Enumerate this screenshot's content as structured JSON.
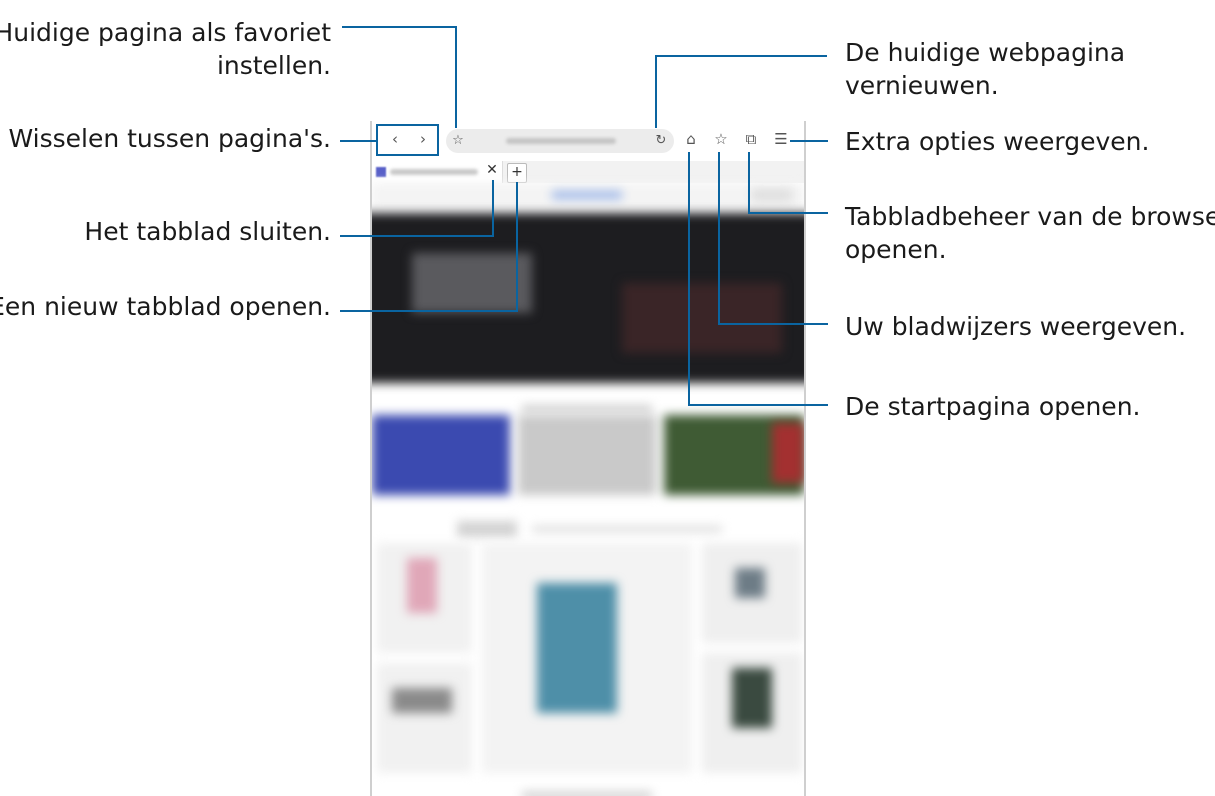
{
  "callouts": {
    "favorite": [
      "Huidige pagina als favoriet",
      "instellen."
    ],
    "switch_pages": "Wisselen tussen pagina's.",
    "close_tab": "Het tabblad sluiten.",
    "new_tab": "Een nieuw tabblad openen.",
    "refresh": [
      "De huidige webpagina",
      "vernieuwen."
    ],
    "extra_options": "Extra opties weergeven.",
    "tab_manager": [
      "Tabbladbeheer van de browser",
      "openen."
    ],
    "bookmarks": "Uw bladwijzers weergeven.",
    "homepage": "De startpagina openen."
  },
  "browser": {
    "icons": {
      "back": "chevron-left-icon",
      "forward": "chevron-right-icon",
      "favorite": "star-icon",
      "refresh": "refresh-icon",
      "home": "home-icon",
      "bookmarks": "bookmark-star-icon",
      "tabs": "tabs-icon",
      "menu": "menu-icon",
      "close_tab": "close-icon",
      "new_tab": "plus-icon"
    },
    "glyphs": {
      "back": "‹",
      "forward": "›",
      "favorite": "☆",
      "refresh": "↻",
      "home": "⌂",
      "bookmarks": "☆",
      "tabs": "⧉",
      "menu": "☰",
      "close_tab": "✕",
      "new_tab": "+"
    }
  },
  "colors": {
    "leader": "#0a64a0",
    "accent_tab_icon": "#5860c8"
  }
}
